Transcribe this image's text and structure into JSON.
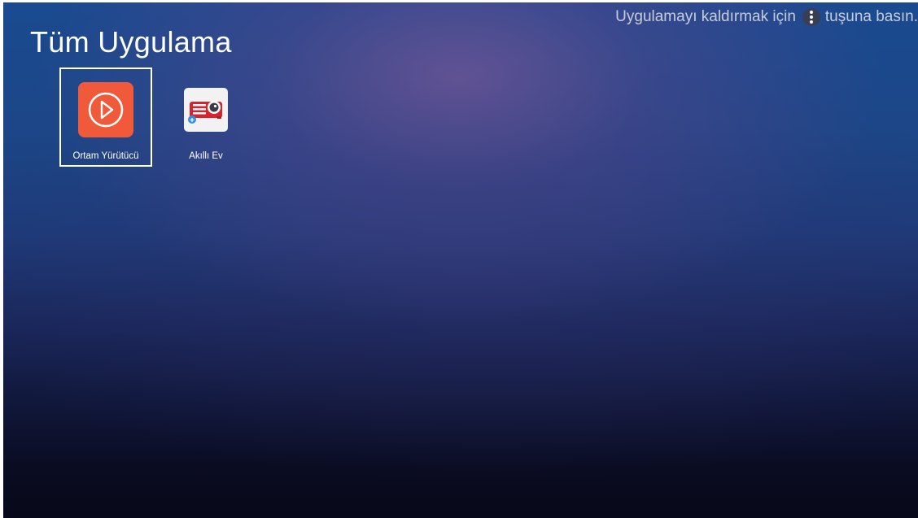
{
  "page": {
    "title": "Tüm Uygulama",
    "hint_before": "Uygulamayı kaldırmak için",
    "hint_icon": "menu-dots-icon",
    "hint_after": "tuşuna basın."
  },
  "apps": [
    {
      "label": "Ortam Yürütücü",
      "icon": "play-circle-icon",
      "icon_color": "#f05a3a",
      "selected": true
    },
    {
      "label": "Akıllı Ev",
      "icon": "smart-home-projector-icon",
      "icon_color": "#d8232f",
      "selected": false
    }
  ],
  "colors": {
    "accent": "#f05a3a",
    "text": "#ffffff",
    "hint_text": "#c8ccda"
  }
}
